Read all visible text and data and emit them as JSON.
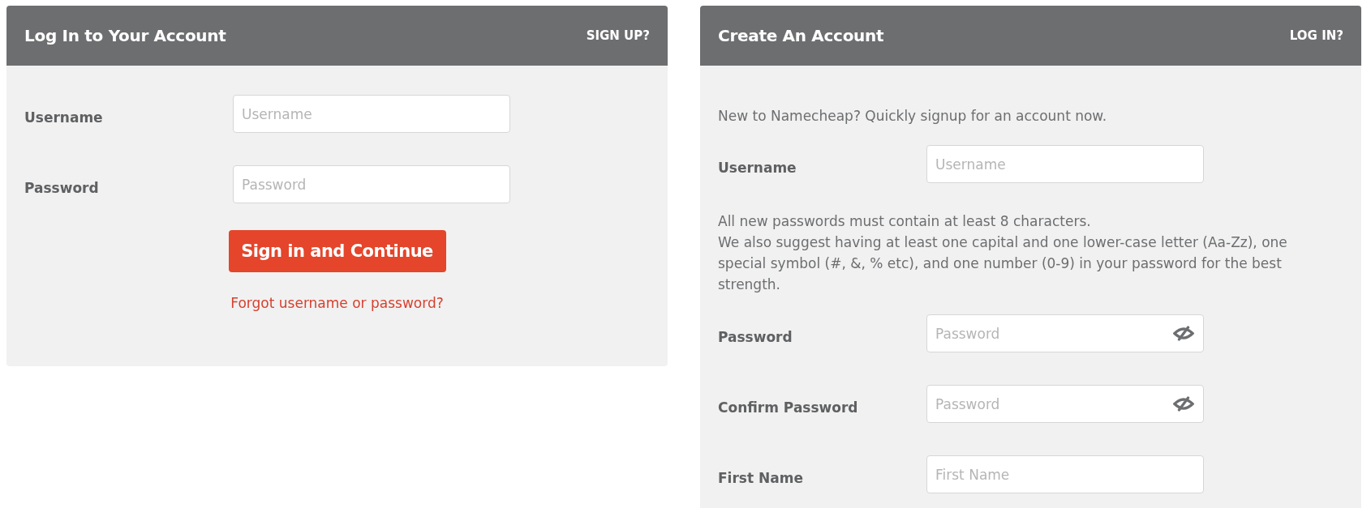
{
  "login": {
    "title": "Log In to Your Account",
    "switch_link": "SIGN UP?",
    "fields": [
      {
        "label": "Username",
        "placeholder": "Username"
      },
      {
        "label": "Password",
        "placeholder": "Password"
      }
    ],
    "button": "Sign in and Continue",
    "forgot_link": "Forgot username or password?"
  },
  "signup": {
    "title": "Create An Account",
    "switch_link": "LOG IN?",
    "items": [
      {
        "kind": "text",
        "text": "New to Namecheap? Quickly signup for an account now."
      },
      {
        "kind": "field",
        "label": "Username",
        "placeholder": "Username",
        "password_toggle": false
      },
      {
        "kind": "note",
        "lines": [
          "All new passwords must contain at least 8 characters.",
          "We also suggest having at least one capital and one lower-case letter (Aa-Zz), one special symbol (#, &, % etc), and one number (0-9) in your password for the best strength."
        ]
      },
      {
        "kind": "field",
        "label": "Password",
        "placeholder": "Password",
        "password_toggle": true
      },
      {
        "kind": "field",
        "label": "Confirm Password",
        "placeholder": "Password",
        "password_toggle": true
      },
      {
        "kind": "field",
        "label": "First Name",
        "placeholder": "First Name",
        "password_toggle": false
      }
    ]
  }
}
